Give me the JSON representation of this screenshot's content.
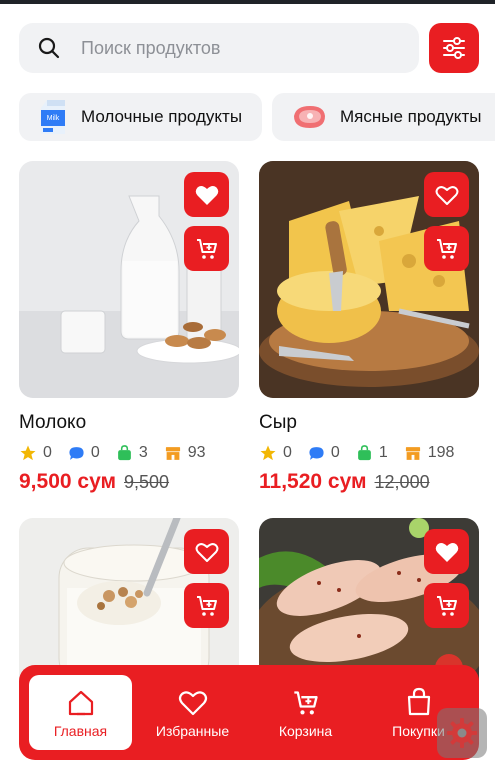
{
  "search": {
    "placeholder": "Поиск продуктов"
  },
  "categories": [
    {
      "label": "Молочные продукты",
      "icon": "milk-carton-icon"
    },
    {
      "label": "Мясные продукты",
      "icon": "meat-icon"
    }
  ],
  "products": [
    {
      "name": "Молоко",
      "rating": "0",
      "comments": "0",
      "orders": "3",
      "stock": "93",
      "price": "9,500 сум",
      "old_price": "9,500",
      "favorite": true,
      "image": "milk-jug-photo"
    },
    {
      "name": "Сыр",
      "rating": "0",
      "comments": "0",
      "orders": "1",
      "stock": "198",
      "price": "11,520 сум",
      "old_price": "12,000",
      "favorite": false,
      "image": "cheese-board-photo"
    },
    {
      "name": "",
      "favorite": false,
      "image": "yogurt-jar-photo"
    },
    {
      "name": "",
      "favorite": true,
      "image": "chicken-drumsticks-photo"
    }
  ],
  "nav": [
    {
      "label": "Главная",
      "icon": "home-icon",
      "active": true
    },
    {
      "label": "Избранные",
      "icon": "heart-icon",
      "active": false
    },
    {
      "label": "Корзина",
      "icon": "cart-icon",
      "active": false
    },
    {
      "label": "Покупки",
      "icon": "shopping-bag-icon",
      "active": false
    }
  ],
  "colors": {
    "accent": "#e91e22",
    "chip_bg": "#f1f2f4",
    "star": "#f2b705",
    "comment": "#2f7cf6",
    "orders": "#2fbf59",
    "stock": "#f39c22"
  }
}
